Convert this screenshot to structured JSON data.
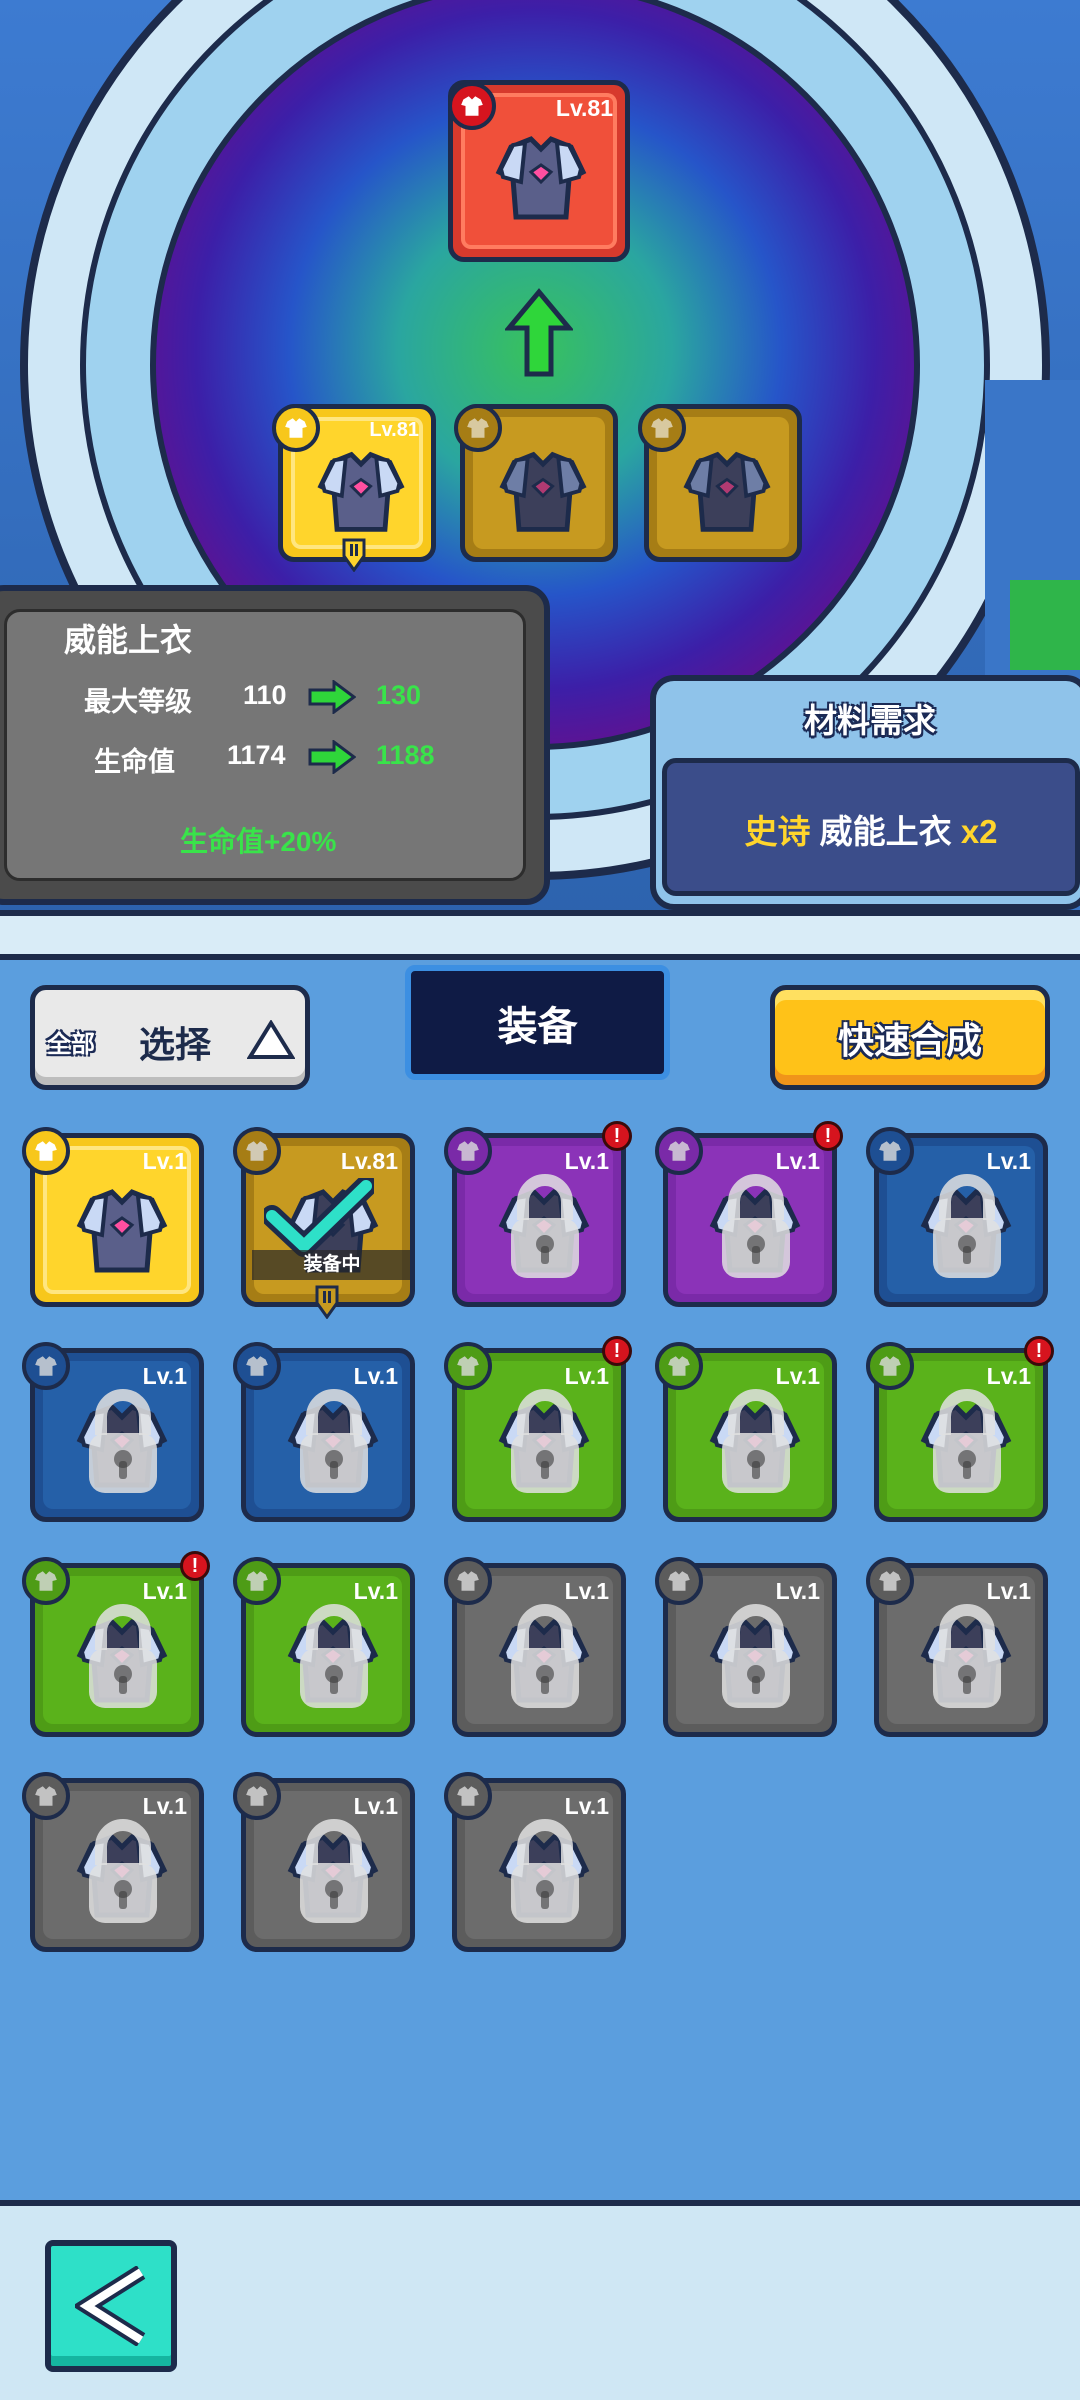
{
  "top": {
    "result_item": {
      "level": "Lv.81"
    },
    "materials": [
      {
        "level": "Lv.81"
      },
      {
        "level": ""
      },
      {
        "level": ""
      }
    ]
  },
  "stats": {
    "name": "威能上衣",
    "rows": [
      {
        "label": "最大等级",
        "from": "110",
        "to": "130"
      },
      {
        "label": "生命值",
        "from": "1174",
        "to": "1188"
      }
    ],
    "bonus": "生命值+20%"
  },
  "materials_panel": {
    "title": "材料需求",
    "rarity": "史诗",
    "item": "威能上衣",
    "count": "x2"
  },
  "toolbar": {
    "filter_all": "全部",
    "select_label": "选择",
    "tab_label": "装备",
    "quick_merge": "快速合成"
  },
  "equipped_label": "装备中",
  "grid": [
    {
      "color": "gold",
      "level": "Lv.1",
      "locked": false,
      "alert": false
    },
    {
      "color": "brown",
      "level": "Lv.81",
      "locked": false,
      "alert": false,
      "equipped": true
    },
    {
      "color": "purple",
      "level": "Lv.1",
      "locked": true,
      "alert": true
    },
    {
      "color": "purple",
      "level": "Lv.1",
      "locked": true,
      "alert": true
    },
    {
      "color": "blue",
      "level": "Lv.1",
      "locked": true,
      "alert": false
    },
    {
      "color": "blue",
      "level": "Lv.1",
      "locked": true,
      "alert": false
    },
    {
      "color": "blue",
      "level": "Lv.1",
      "locked": true,
      "alert": false
    },
    {
      "color": "green",
      "level": "Lv.1",
      "locked": true,
      "alert": true
    },
    {
      "color": "green",
      "level": "Lv.1",
      "locked": true,
      "alert": false
    },
    {
      "color": "green",
      "level": "Lv.1",
      "locked": true,
      "alert": true
    },
    {
      "color": "green",
      "level": "Lv.1",
      "locked": true,
      "alert": true
    },
    {
      "color": "green",
      "level": "Lv.1",
      "locked": true,
      "alert": false
    },
    {
      "color": "grey",
      "level": "Lv.1",
      "locked": true,
      "alert": false
    },
    {
      "color": "grey",
      "level": "Lv.1",
      "locked": true,
      "alert": false
    },
    {
      "color": "grey",
      "level": "Lv.1",
      "locked": true,
      "alert": false
    },
    {
      "color": "grey",
      "level": "Lv.1",
      "locked": true,
      "alert": false
    },
    {
      "color": "grey",
      "level": "Lv.1",
      "locked": true,
      "alert": false
    },
    {
      "color": "grey",
      "level": "Lv.1",
      "locked": true,
      "alert": false
    }
  ],
  "colors": {
    "gold": "#f7c71b",
    "brown": "#a67d15",
    "purple": "#7a2aa8",
    "blue": "#1e4f93",
    "green": "#4e9c16",
    "grey": "#5c5c5c",
    "red": "#d73a2d"
  }
}
